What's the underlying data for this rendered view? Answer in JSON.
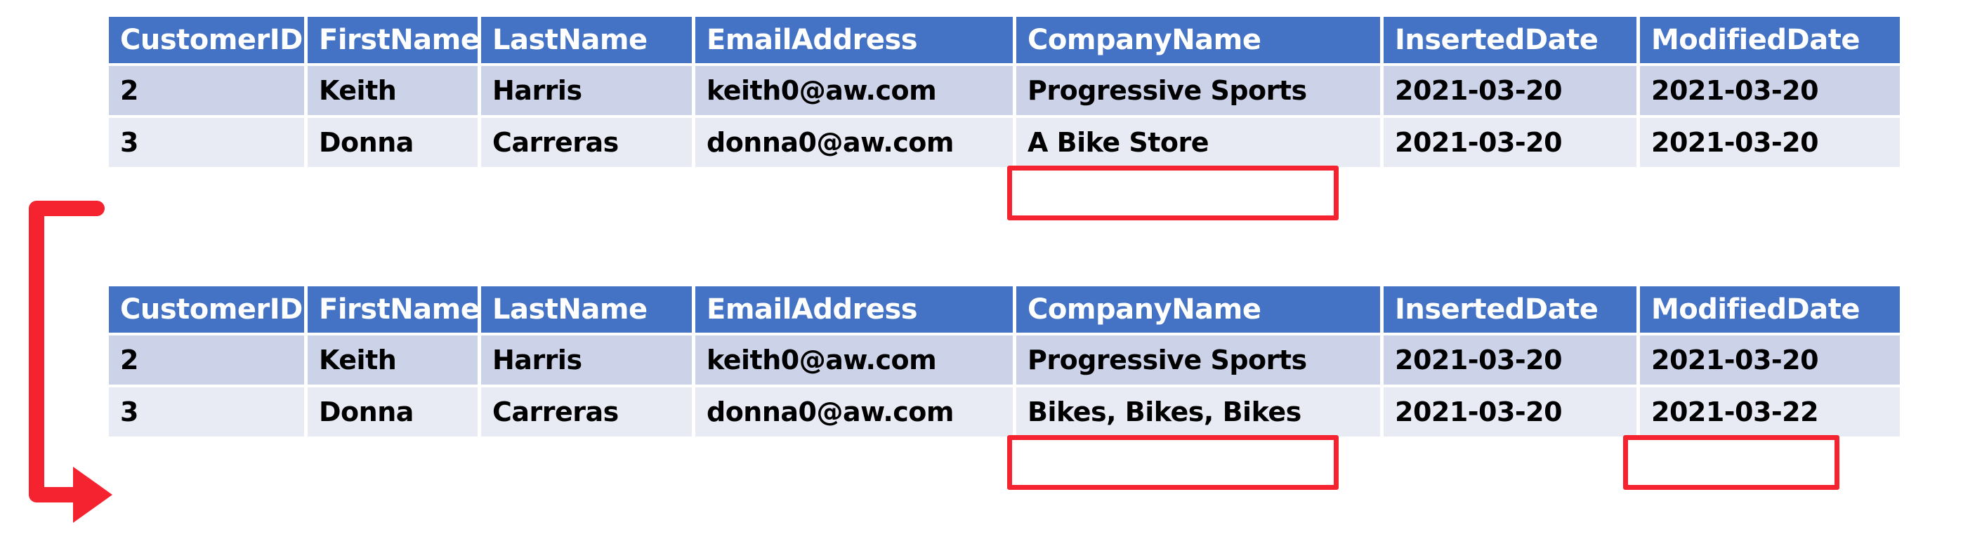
{
  "tables": [
    {
      "name": "before-update-result",
      "columns": [
        "CustomerID",
        "FirstName",
        "LastName",
        "EmailAddress",
        "CompanyName",
        "InsertedDate",
        "ModifiedDate"
      ],
      "rows": [
        {
          "CustomerID": "2",
          "FirstName": "Keith",
          "LastName": "Harris",
          "EmailAddress": "keith0@aw.com",
          "CompanyName": "Progressive Sports",
          "InsertedDate": "2021-03-20",
          "ModifiedDate": "2021-03-20"
        },
        {
          "CustomerID": "3",
          "FirstName": "Donna",
          "LastName": "Carreras",
          "EmailAddress": "donna0@aw.com",
          "CompanyName": "A Bike Store",
          "InsertedDate": "2021-03-20",
          "ModifiedDate": "2021-03-20"
        }
      ]
    },
    {
      "name": "after-update-result",
      "columns": [
        "CustomerID",
        "FirstName",
        "LastName",
        "EmailAddress",
        "CompanyName",
        "InsertedDate",
        "ModifiedDate"
      ],
      "rows": [
        {
          "CustomerID": "2",
          "FirstName": "Keith",
          "LastName": "Harris",
          "EmailAddress": "keith0@aw.com",
          "CompanyName": "Progressive Sports",
          "InsertedDate": "2021-03-20",
          "ModifiedDate": "2021-03-20"
        },
        {
          "CustomerID": "3",
          "FirstName": "Donna",
          "LastName": "Carreras",
          "EmailAddress": "donna0@aw.com",
          "CompanyName": "Bikes, Bikes, Bikes",
          "InsertedDate": "2021-03-20",
          "ModifiedDate": "2021-03-22"
        }
      ]
    }
  ],
  "annotations": {
    "highlight_color": "#f5232f",
    "header_color": "#4472c4",
    "row_band_a_color": "#ccd2e8",
    "row_band_b_color": "#e8eaf4",
    "boxes": [
      {
        "name": "companyname-before",
        "target": "A Bike Store"
      },
      {
        "name": "companyname-after",
        "target": "Bikes, Bikes, Bikes"
      },
      {
        "name": "modifieddate-after",
        "target": "2021-03-22"
      }
    ],
    "arrow": {
      "name": "row-link-arrow",
      "from": "before-update row CustomerID 3",
      "to": "after-update row CustomerID 3"
    }
  }
}
